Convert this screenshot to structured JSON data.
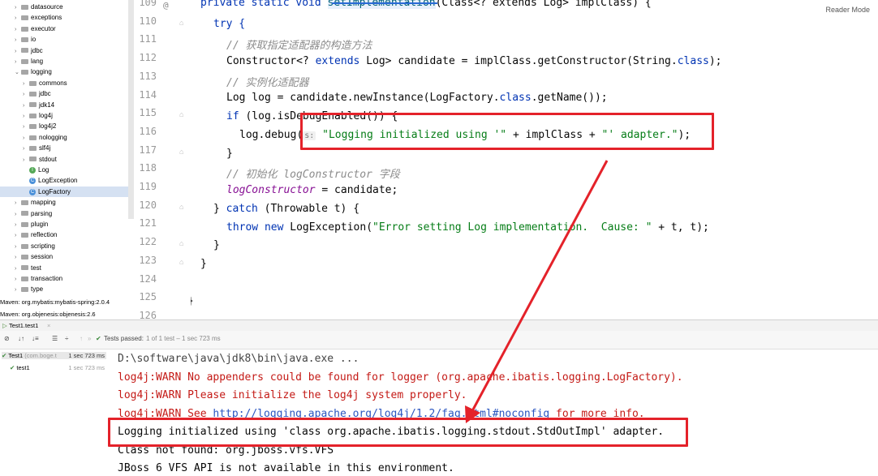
{
  "tree": {
    "items": [
      {
        "label": "datasource",
        "kind": "folder",
        "depth": 0,
        "arrow": ">"
      },
      {
        "label": "exceptions",
        "kind": "folder",
        "depth": 0,
        "arrow": ">"
      },
      {
        "label": "executor",
        "kind": "folder",
        "depth": 0,
        "arrow": ">"
      },
      {
        "label": "io",
        "kind": "folder",
        "depth": 0,
        "arrow": ">"
      },
      {
        "label": "jdbc",
        "kind": "folder",
        "depth": 0,
        "arrow": ">"
      },
      {
        "label": "lang",
        "kind": "folder",
        "depth": 0,
        "arrow": ">"
      },
      {
        "label": "logging",
        "kind": "folder",
        "depth": 0,
        "arrow": "v"
      },
      {
        "label": "commons",
        "kind": "folder",
        "depth": 1,
        "arrow": ">"
      },
      {
        "label": "jdbc",
        "kind": "folder",
        "depth": 1,
        "arrow": ">"
      },
      {
        "label": "jdk14",
        "kind": "folder",
        "depth": 1,
        "arrow": ">"
      },
      {
        "label": "log4j",
        "kind": "folder",
        "depth": 1,
        "arrow": ">"
      },
      {
        "label": "log4j2",
        "kind": "folder",
        "depth": 1,
        "arrow": ">"
      },
      {
        "label": "nologging",
        "kind": "folder",
        "depth": 1,
        "arrow": ">"
      },
      {
        "label": "slf4j",
        "kind": "folder",
        "depth": 1,
        "arrow": ">"
      },
      {
        "label": "stdout",
        "kind": "folder",
        "depth": 1,
        "arrow": ">"
      },
      {
        "label": "Log",
        "kind": "interface",
        "depth": 1,
        "arrow": ""
      },
      {
        "label": "LogException",
        "kind": "class",
        "depth": 1,
        "arrow": ""
      },
      {
        "label": "LogFactory",
        "kind": "class",
        "depth": 1,
        "arrow": "",
        "selected": true
      },
      {
        "label": "mapping",
        "kind": "folder",
        "depth": 0,
        "arrow": ">"
      },
      {
        "label": "parsing",
        "kind": "folder",
        "depth": 0,
        "arrow": ">"
      },
      {
        "label": "plugin",
        "kind": "folder",
        "depth": 0,
        "arrow": ">"
      },
      {
        "label": "reflection",
        "kind": "folder",
        "depth": 0,
        "arrow": ">"
      },
      {
        "label": "scripting",
        "kind": "folder",
        "depth": 0,
        "arrow": ">"
      },
      {
        "label": "session",
        "kind": "folder",
        "depth": 0,
        "arrow": ">"
      },
      {
        "label": "test",
        "kind": "folder",
        "depth": 0,
        "arrow": ">"
      },
      {
        "label": "transaction",
        "kind": "folder",
        "depth": 0,
        "arrow": ">"
      },
      {
        "label": "type",
        "kind": "folder",
        "depth": 0,
        "arrow": ">"
      }
    ],
    "maven": [
      "Maven: org.mybatis:mybatis-spring:2.0.4",
      "Maven: org.objenesis:objenesis:2.6"
    ]
  },
  "editor": {
    "reader_mode": "Reader Mode",
    "line_numbers": [
      "109",
      "110",
      "111",
      "112",
      "113",
      "114",
      "115",
      "116",
      "117",
      "118",
      "119",
      "120",
      "121",
      "122",
      "123",
      "124",
      "125",
      "126"
    ],
    "lines": {
      "l109": {
        "a": "private static void ",
        "b": "setImplementation",
        "c": "(Class<? extends Log> implClass) {"
      },
      "l110": {
        "a": "try {"
      },
      "l111": "// 获取指定适配器的构造方法",
      "l112": {
        "a": "Constructor<? ",
        "b": "extends",
        "c": " Log> candidate = implClass.getConstructor(String.",
        "d": "class",
        "e": ");"
      },
      "l113": "// 实例化适配器",
      "l114": {
        "a": "Log log = candidate.newInstance(LogFactory.",
        "b": "class",
        "c": ".getName());"
      },
      "l115": {
        "a": "if",
        "b": " (log.isDebugEnabled()) {"
      },
      "l116": {
        "a": "log.debug(",
        "hint": "s:",
        "b": "\"Logging initialized using '\"",
        "c": " + implClass + ",
        "d": "\"' adapter.\"",
        "e": ");"
      },
      "l117": "}",
      "l118": "// 初始化 logConstructor 字段",
      "l119": {
        "a": "logConstructor",
        "b": " = candidate;"
      },
      "l120": {
        "a": "} ",
        "b": "catch",
        "c": " (Throwable t) {"
      },
      "l121": {
        "a": "throw new",
        "b": " LogException(",
        "c": "\"Error setting Log implementation.  Cause: \"",
        "d": " + t, t);"
      },
      "l122": "}",
      "l123": "}",
      "l125": "}"
    }
  },
  "run": {
    "tab_label": "Test1.test1",
    "tests_passed_label": "Tests passed:",
    "tests_passed_detail": "1 of 1 test – 1 sec 723 ms",
    "tests": [
      {
        "name": "Test1",
        "detail": "(com.boge.t",
        "time": "1 sec 723 ms"
      },
      {
        "name": "test1",
        "detail": "",
        "time": "1 sec 723 ms"
      }
    ],
    "console": {
      "l1": "D:\\software\\java\\jdk8\\bin\\java.exe ...",
      "l2": "log4j:WARN No appenders could be found for logger (org.apache.ibatis.logging.LogFactory).",
      "l3": "log4j:WARN Please initialize the log4j system properly.",
      "l4a": "log4j:WARN See ",
      "l4link": "http://logging.apache.org/log4j/1.2/faq.html#noconfig",
      "l4b": " for more info.",
      "l5": "Logging initialized using 'class org.apache.ibatis.logging.stdout.StdOutImpl' adapter.",
      "l6": "Class not found: org.jboss.vfs.VFS",
      "l7": "JBoss 6 VFS API is not available in this environment."
    }
  },
  "colors": {
    "annotation": "#e4222a",
    "keyword": "#0033b3",
    "string": "#067d17",
    "comment": "#8c8c8c"
  }
}
